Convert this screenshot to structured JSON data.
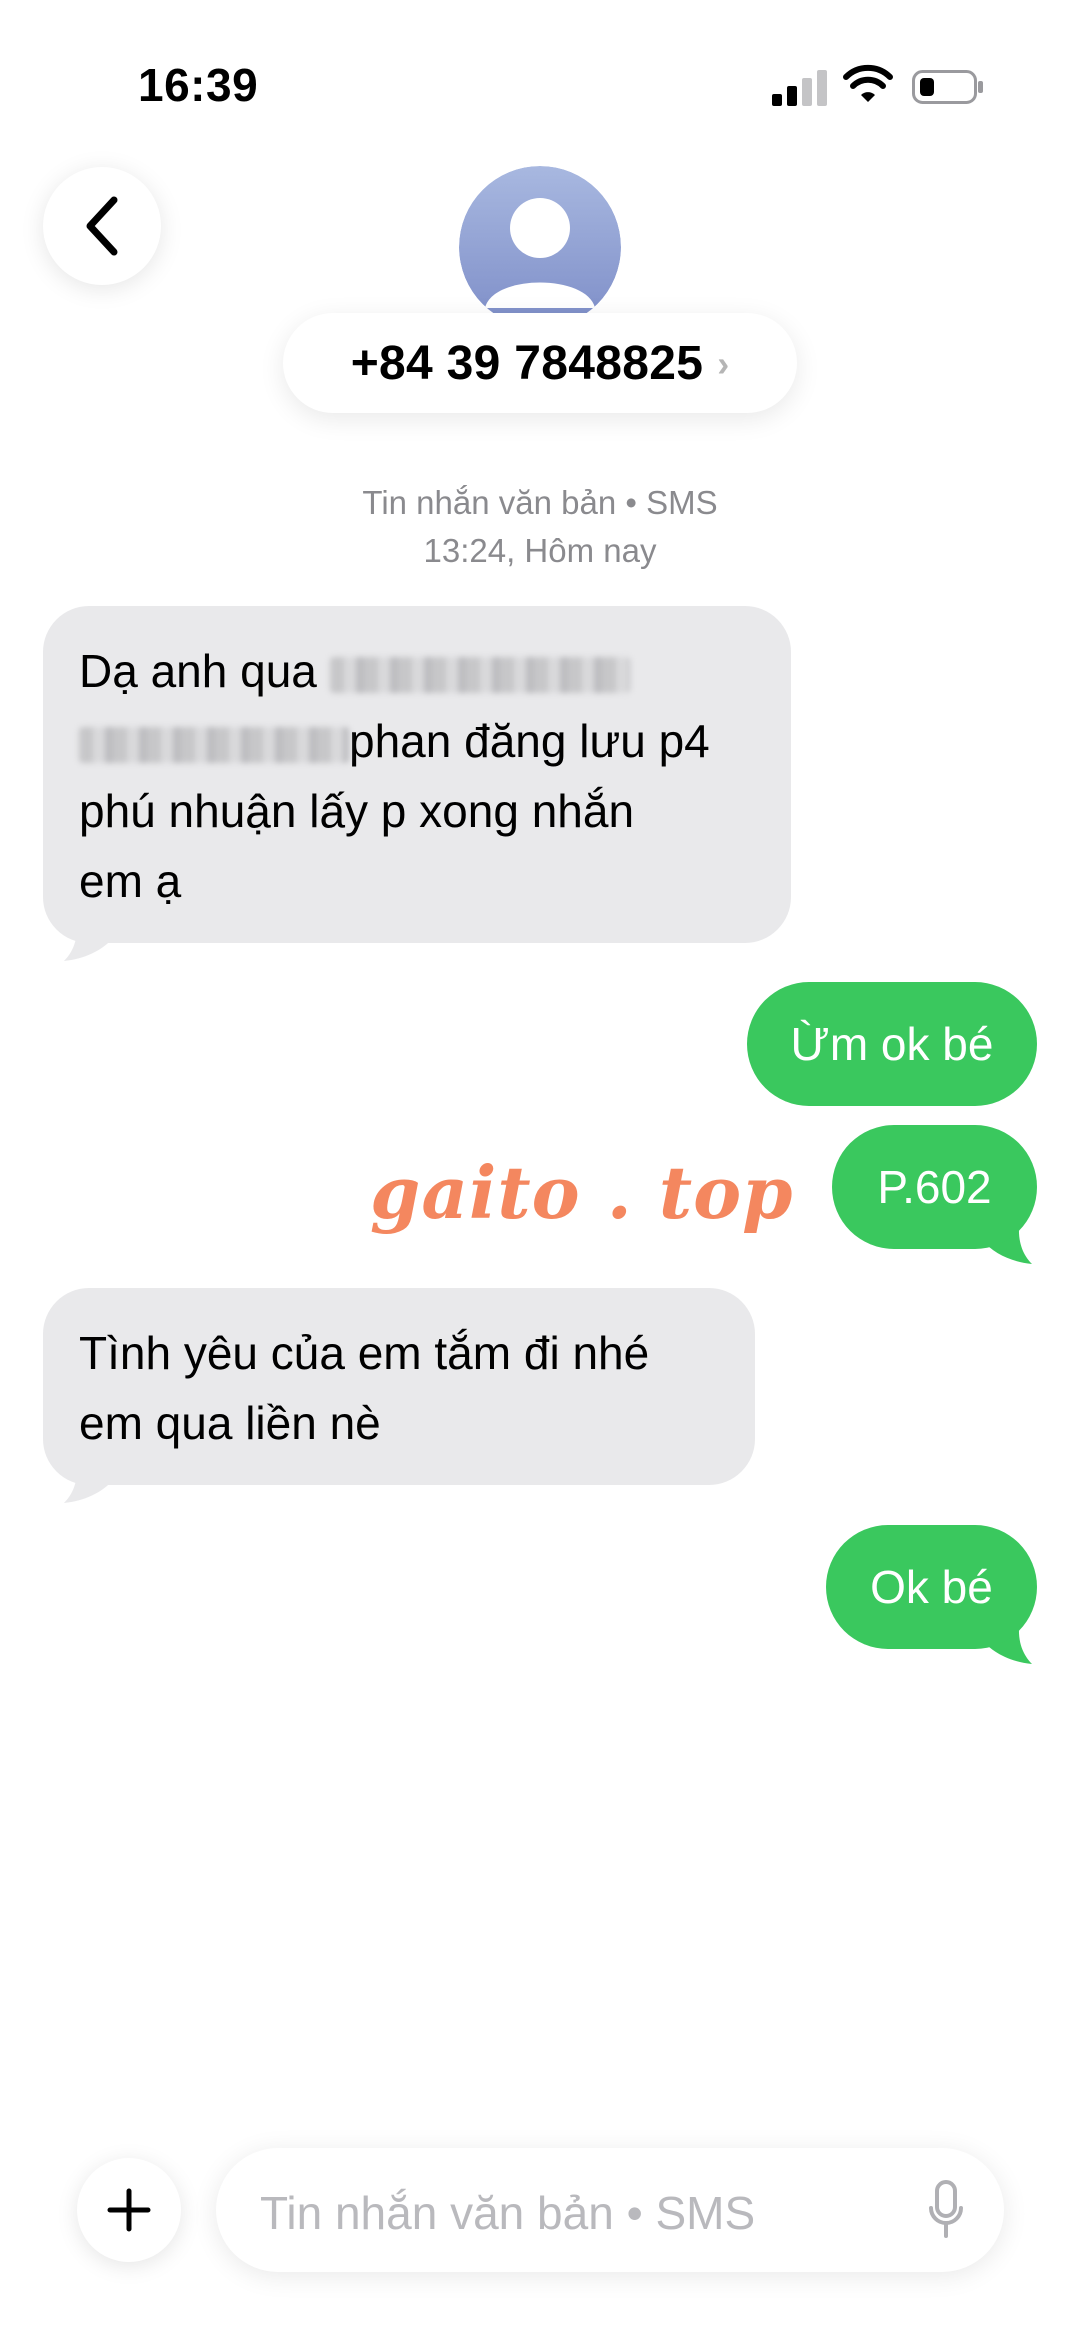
{
  "status_bar": {
    "time": "16:39"
  },
  "header": {
    "contact_number": "+84 39 7848825",
    "chevron": "›"
  },
  "thread_meta": {
    "channel": "Tin nhắn văn bản • SMS",
    "timestamp": "13:24, Hôm nay"
  },
  "messages": [
    {
      "direction": "incoming",
      "lines": [
        "Dạ anh qua ",
        "phan đăng lưu p4",
        "phú nhuận lấy p xong nhắn",
        "em ạ"
      ],
      "redacted": true
    },
    {
      "direction": "outgoing",
      "text": "Ừm ok bé"
    },
    {
      "direction": "outgoing",
      "text": "P.602"
    },
    {
      "direction": "incoming",
      "lines": [
        "Tình yêu của em tắm đi nhé",
        "em qua liền nè"
      ]
    },
    {
      "direction": "outgoing",
      "text": "Ok bé"
    }
  ],
  "watermark": "gaito . top",
  "composer": {
    "add_icon": "plus-icon",
    "placeholder": "Tin nhắn văn bản • SMS",
    "mic_icon": "microphone-icon"
  },
  "colors": {
    "outgoing_bubble": "#3ac85e",
    "incoming_bubble": "#e9e9eb",
    "watermark": "#f4875f",
    "meta_text": "#8a8a8e"
  }
}
